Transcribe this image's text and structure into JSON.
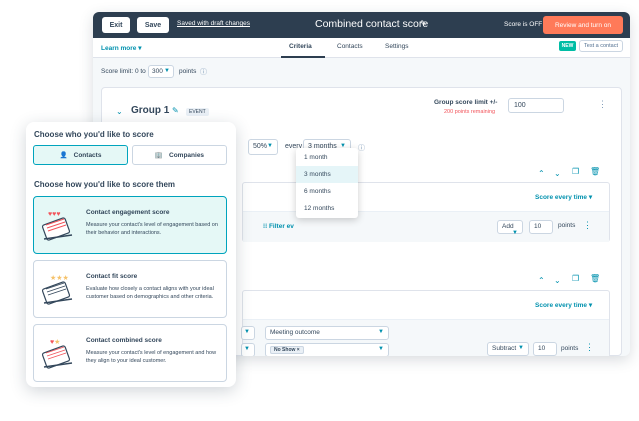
{
  "topbar": {
    "exit_label": "Exit",
    "save_label": "Save",
    "saved_status": "Saved with draft changes",
    "title": "Combined contact score",
    "score_status": "Score is OFF",
    "review_label": "Review and turn on"
  },
  "tabs": {
    "learn_more": "Learn more",
    "items": [
      "Criteria",
      "Contacts",
      "Settings"
    ],
    "new_badge": "NEW",
    "test_contact": "Test a contact"
  },
  "score_limit": {
    "label": "Score limit: 0 to",
    "value": "300",
    "unit": "points"
  },
  "group": {
    "title": "Group 1",
    "badge": "EVENT",
    "score_limit_label": "Group score limit +/-",
    "remaining": "200 points remaining",
    "limit_value": "100",
    "percent": "50%",
    "every_label": "every",
    "period": "3 months"
  },
  "period_options": [
    "1 month",
    "3 months",
    "6 months",
    "12 months"
  ],
  "section1": {
    "score_every": "Score every time",
    "filter_label": "Filter ev",
    "action": "Add",
    "points": "10",
    "points_label": "points"
  },
  "section2": {
    "score_every": "Score every time",
    "property": "Meeting outcome",
    "value_tag": "No Show",
    "action": "Subtract",
    "points": "10",
    "points_label": "points"
  },
  "panel": {
    "choose_who": "Choose who you'd like to score",
    "contacts": "Contacts",
    "companies": "Companies",
    "choose_how": "Choose how you'd like to score them",
    "options": [
      {
        "title": "Contact engagement score",
        "desc": "Measure your contact's level of engagement based on their behavior and interactions."
      },
      {
        "title": "Contact fit score",
        "desc": "Evaluate how closely a contact aligns with your ideal customer based on demographics and other criteria."
      },
      {
        "title": "Contact combined score",
        "desc": "Measure your contact's level of engagement and how they align to your ideal customer."
      }
    ]
  },
  "colors": {
    "accent": "#ff7a59",
    "teal": "#00a4bd",
    "navy": "#2d3e50",
    "link": "#0091ae"
  }
}
